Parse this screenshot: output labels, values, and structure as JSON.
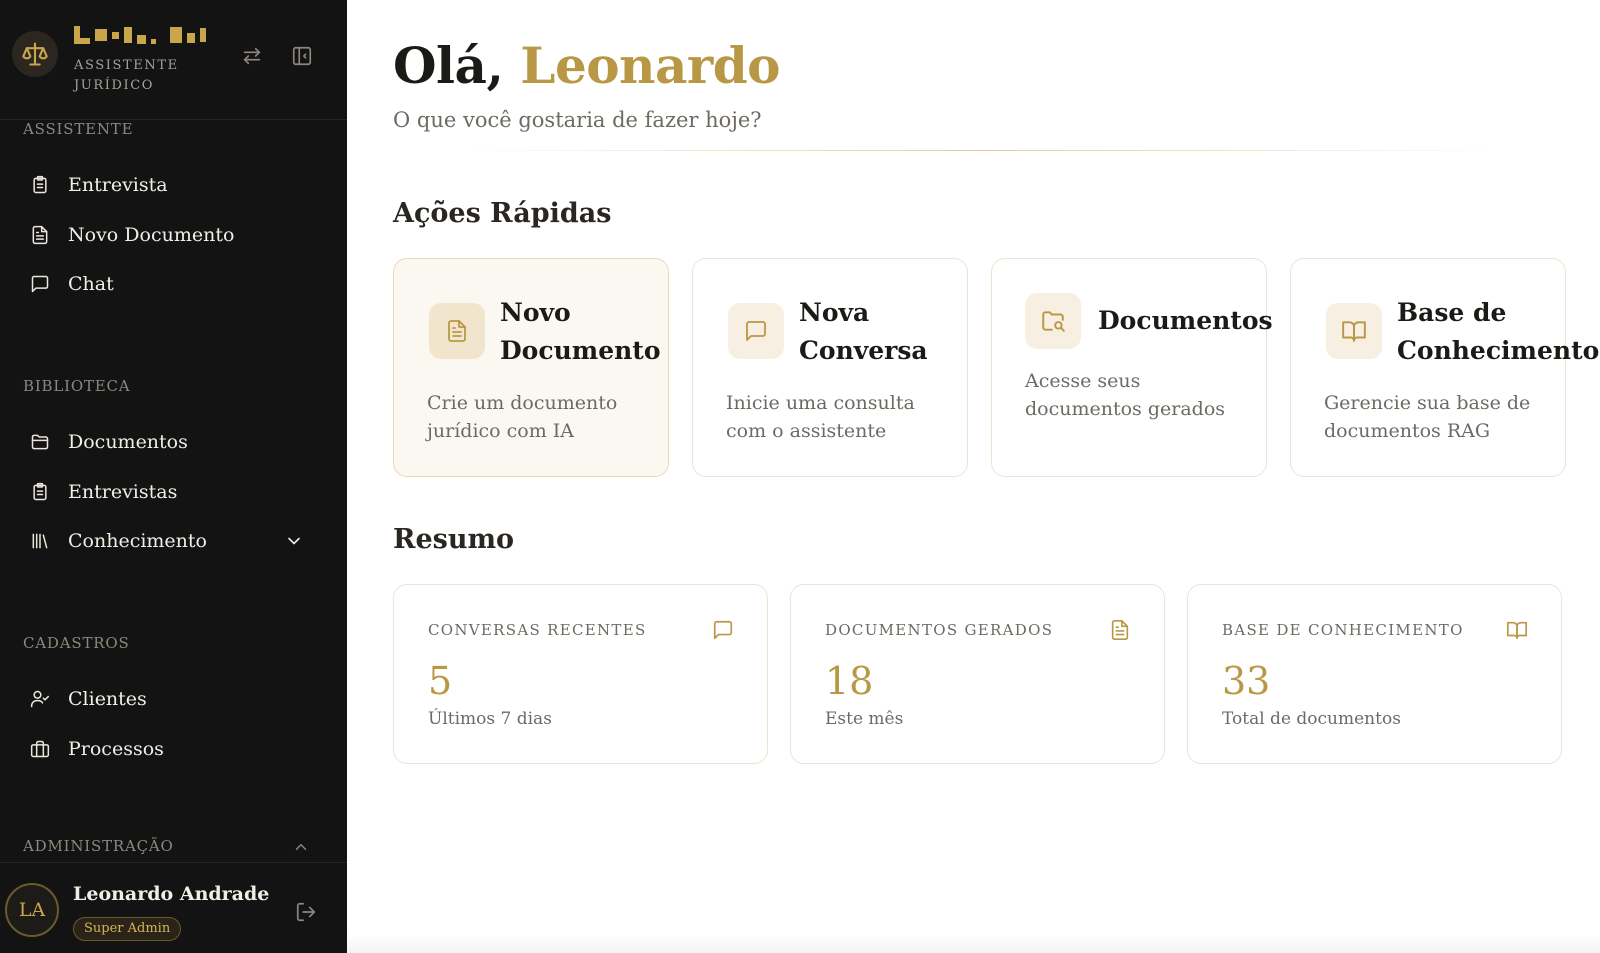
{
  "colors": {
    "accent_gold": "#b99845",
    "sidebar_bg": "#131313",
    "card_border": "#eee4d3"
  },
  "brand": {
    "logo_icon": "scales-icon",
    "subtitle": "ASSISTENTE\nJURÍDICO",
    "swap_icon": "swap-arrows-icon",
    "collapse_icon": "sidebar-collapse-icon"
  },
  "sidebar": {
    "sections": [
      {
        "label": "ASSISTENTE",
        "items": [
          {
            "label": "Entrevista",
            "icon": "clipboard-icon"
          },
          {
            "label": "Novo Documento",
            "icon": "document-icon"
          },
          {
            "label": "Chat",
            "icon": "chat-icon"
          }
        ]
      },
      {
        "label": "BIBLIOTECA",
        "items": [
          {
            "label": "Documentos",
            "icon": "folder-icon"
          },
          {
            "label": "Entrevistas",
            "icon": "clipboard-icon"
          },
          {
            "label": "Conhecimento",
            "icon": "library-icon",
            "chevron": "chevron-down-icon"
          }
        ]
      },
      {
        "label": "CADASTROS",
        "items": [
          {
            "label": "Clientes",
            "icon": "user-check-icon"
          },
          {
            "label": "Processos",
            "icon": "briefcase-icon"
          }
        ]
      },
      {
        "label": "ADMINISTRAÇÃO",
        "chevron": "chevron-up-icon"
      }
    ]
  },
  "user": {
    "initials": "LA",
    "name": "Leonardo Andrade",
    "role": "Super Admin",
    "logout_icon": "logout-icon"
  },
  "main": {
    "greeting_prefix": "Olá,",
    "greeting_name": "Leonardo",
    "subtitle": "O que você gostaria de fazer hoje?",
    "quick_actions_title": "Ações Rápidas",
    "quick_actions": [
      {
        "title": "Novo Documento",
        "title_lines": [
          "Novo",
          "Documento"
        ],
        "desc": "Crie um documento jurídico com IA",
        "icon": "document-icon",
        "active": true
      },
      {
        "title": "Nova Conversa",
        "title_lines": [
          "Nova",
          "Conversa"
        ],
        "desc": "Inicie uma consulta com o assistente",
        "icon": "chat-icon",
        "active": false
      },
      {
        "title": "Documentos",
        "title_lines": [
          "Documentos"
        ],
        "desc": "Acesse seus documentos gerados",
        "icon": "folder-search-icon",
        "active": false
      },
      {
        "title": "Base de Conhecimento",
        "title_lines": [
          "Base de",
          "Conhecimento"
        ],
        "desc": "Gerencie sua base de documentos RAG",
        "icon": "book-open-icon",
        "active": false
      }
    ],
    "summary_title": "Resumo",
    "stats": [
      {
        "label": "CONVERSAS RECENTES",
        "value": "5",
        "note": "Últimos 7 dias",
        "icon": "chat-icon"
      },
      {
        "label": "DOCUMENTOS GERADOS",
        "value": "18",
        "note": "Este mês",
        "icon": "document-icon"
      },
      {
        "label": "BASE DE CONHECIMENTO",
        "value": "33",
        "note": "Total de documentos",
        "icon": "book-open-icon"
      }
    ]
  }
}
